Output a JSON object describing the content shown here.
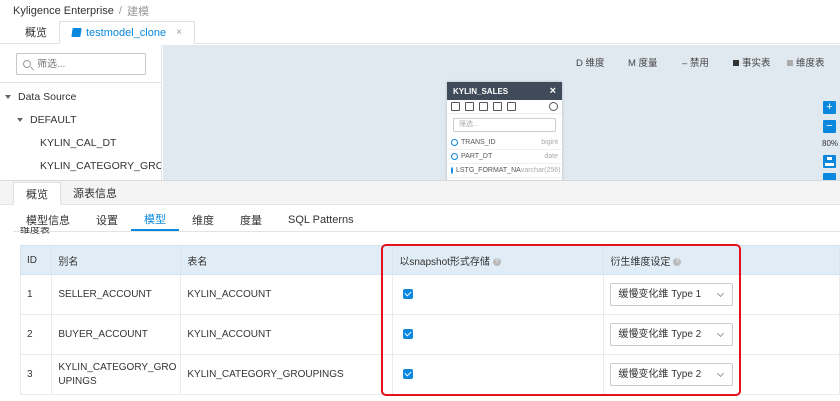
{
  "breadcrumb": {
    "app": "Kyligence Enterprise",
    "separator": "/",
    "page": "建模"
  },
  "editor_tabs": [
    {
      "label": "概览"
    },
    {
      "label": "testmodel_clone",
      "close": "×"
    }
  ],
  "sidebar": {
    "search_placeholder": "筛选...",
    "tree": {
      "root": "Data Source",
      "db": "DEFAULT",
      "tables": [
        "KYLIN_CAL_DT",
        "KYLIN_CATEGORY_GROUPINGS"
      ]
    }
  },
  "canvas": {
    "legend": {
      "dimension": "D  维度",
      "measure": "M  度量",
      "disabled": "–  禁用",
      "fact": "事实表",
      "dim_table": "维度表"
    },
    "zoom_in": "+",
    "zoom_out": "−",
    "zoom_level": "80%",
    "table_card": {
      "title": "KYLIN_SALES",
      "close": "×",
      "filter_placeholder": "筛选...",
      "columns": [
        {
          "name": "TRANS_ID",
          "type": "bigint"
        },
        {
          "name": "PART_DT",
          "type": "date"
        },
        {
          "name": "LSTG_FORMAT_NA",
          "type": "varchar(256)"
        }
      ]
    }
  },
  "panel": {
    "tabs": [
      "概览",
      "源表信息"
    ],
    "subtabs": [
      "模型信息",
      "设置",
      "模型",
      "维度",
      "度量",
      "SQL Patterns"
    ],
    "section_title": "维度表",
    "table": {
      "headers": [
        "ID",
        "别名",
        "表名",
        "以snapshot形式存储",
        "衍生维度设定"
      ],
      "rows": [
        {
          "id": "1",
          "alias": "SELLER_ACCOUNT",
          "table": "KYLIN_ACCOUNT",
          "snapshot": true,
          "derived": "缓慢变化维 Type 1"
        },
        {
          "id": "2",
          "alias": "BUYER_ACCOUNT",
          "table": "KYLIN_ACCOUNT",
          "snapshot": true,
          "derived": "缓慢变化维 Type 2"
        },
        {
          "id": "3",
          "alias": "KYLIN_CATEGORY_GRO UPINGS",
          "table": "KYLIN_CATEGORY_GROUPINGS",
          "snapshot": true,
          "derived": "缓慢变化维 Type 2"
        }
      ]
    }
  },
  "colors": {
    "accent": "#0988de",
    "highlight": "#e8101c",
    "canvas_bg": "#e0e8f0",
    "table_header": "#e1edf6"
  }
}
